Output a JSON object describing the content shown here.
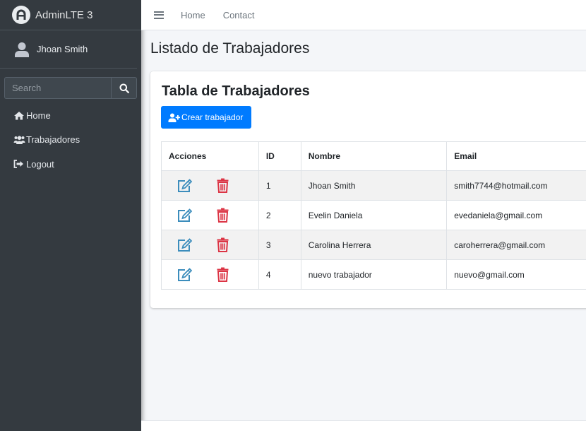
{
  "brand": {
    "name": "AdminLTE 3"
  },
  "user": {
    "name": "Jhoan Smith"
  },
  "search": {
    "placeholder": "Search"
  },
  "sidebar": {
    "items": [
      {
        "label": "Home",
        "icon": "home-icon"
      },
      {
        "label": "Trabajadores",
        "icon": "users-icon"
      },
      {
        "label": "Logout",
        "icon": "sign-out-icon"
      }
    ]
  },
  "topnav": {
    "links": [
      "Home",
      "Contact"
    ]
  },
  "page": {
    "title": "Listado de Trabajadores"
  },
  "card": {
    "title": "Tabla de Trabajadores",
    "create_label": "Crear trabajador"
  },
  "table": {
    "headers": [
      "Acciones",
      "ID",
      "Nombre",
      "Email"
    ],
    "rows": [
      {
        "id": "1",
        "nombre": "Jhoan Smith",
        "email": "smith7744@hotmail.com"
      },
      {
        "id": "2",
        "nombre": "Evelin Daniela",
        "email": "evedaniela@gmail.com"
      },
      {
        "id": "3",
        "nombre": "Carolina Herrera",
        "email": "caroherrera@gmail.com"
      },
      {
        "id": "4",
        "nombre": "nuevo trabajador",
        "email": "nuevo@gmail.com"
      }
    ]
  },
  "colors": {
    "primary": "#007bff",
    "danger": "#dc3545",
    "edit": "#3c8dbc",
    "sidebar": "#343a40"
  }
}
